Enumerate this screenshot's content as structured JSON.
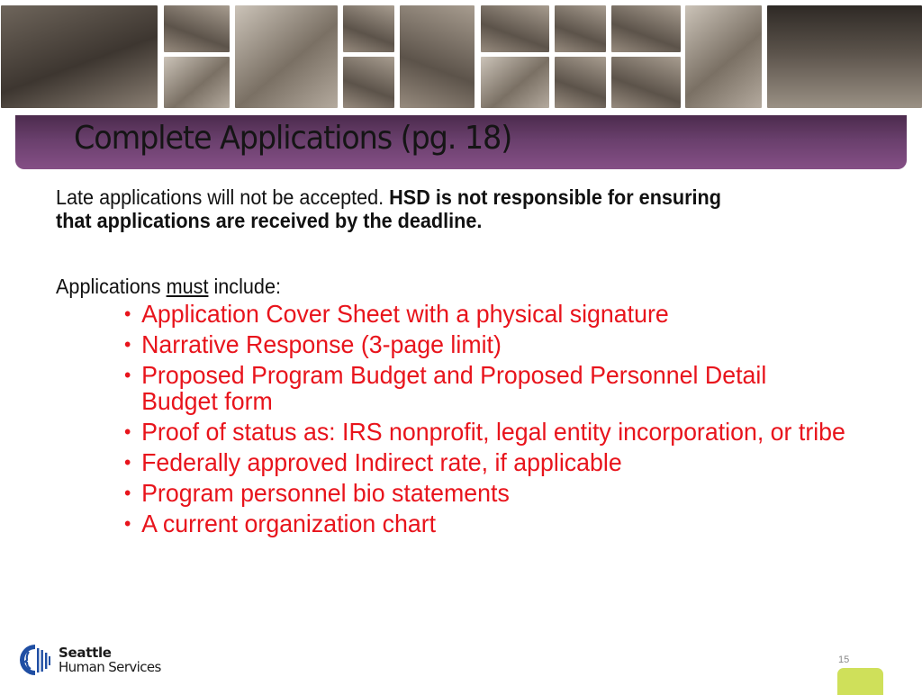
{
  "header": {
    "photo_strip": {
      "description": "sepia photo collage of community members",
      "photos": [
        {
          "name": "family-photo",
          "tone": "dark"
        },
        {
          "name": "children-drawing-photo",
          "tone": "mid"
        },
        {
          "name": "children-computer-photo",
          "tone": "light"
        },
        {
          "name": "youth-poster-photo",
          "tone": "light"
        },
        {
          "name": "child-play-photo",
          "tone": "mid"
        },
        {
          "name": "child-hat-photo",
          "tone": "mid"
        },
        {
          "name": "classroom-photo",
          "tone": "mid"
        },
        {
          "name": "woman-flowers-photo",
          "tone": "mid"
        },
        {
          "name": "woman-cake-photo",
          "tone": "light"
        },
        {
          "name": "two-women-photo",
          "tone": "mid"
        },
        {
          "name": "office-photo",
          "tone": "mid"
        },
        {
          "name": "woman-kitchen-photo",
          "tone": "mid"
        },
        {
          "name": "man-table-photo",
          "tone": "mid"
        },
        {
          "name": "food-bank-photo",
          "tone": "light"
        },
        {
          "name": "graduation-crowd-photo",
          "tone": "crowd"
        }
      ]
    }
  },
  "slide": {
    "title": "Complete Applications (pg. 18)",
    "intro_normal": "Late applications will not be accepted. ",
    "intro_bold": "HSD is not responsible for ensuring that applications are received by the deadline.",
    "must_prefix": "Applications ",
    "must_underlined": "must",
    "must_suffix": " include:",
    "requirements": [
      "Application Cover Sheet with a physical signature",
      "Narrative Response (3-page limit)",
      "Proposed Program Budget and Proposed Personnel Detail Budget form",
      "Proof of status as: IRS nonprofit, legal entity incorporation, or tribe",
      "Federally approved Indirect rate, if applicable",
      "Program personnel bio statements",
      "A current organization chart"
    ],
    "bullet": "•"
  },
  "footer": {
    "logo_line1": "Seattle",
    "logo_line2": "Human Services",
    "page_number": "15"
  },
  "colors": {
    "title_bar": "#693f6c",
    "requirement_text": "#e8141c",
    "logo_blue": "#1f4ea3",
    "corner_tab": "#cfe05a"
  }
}
